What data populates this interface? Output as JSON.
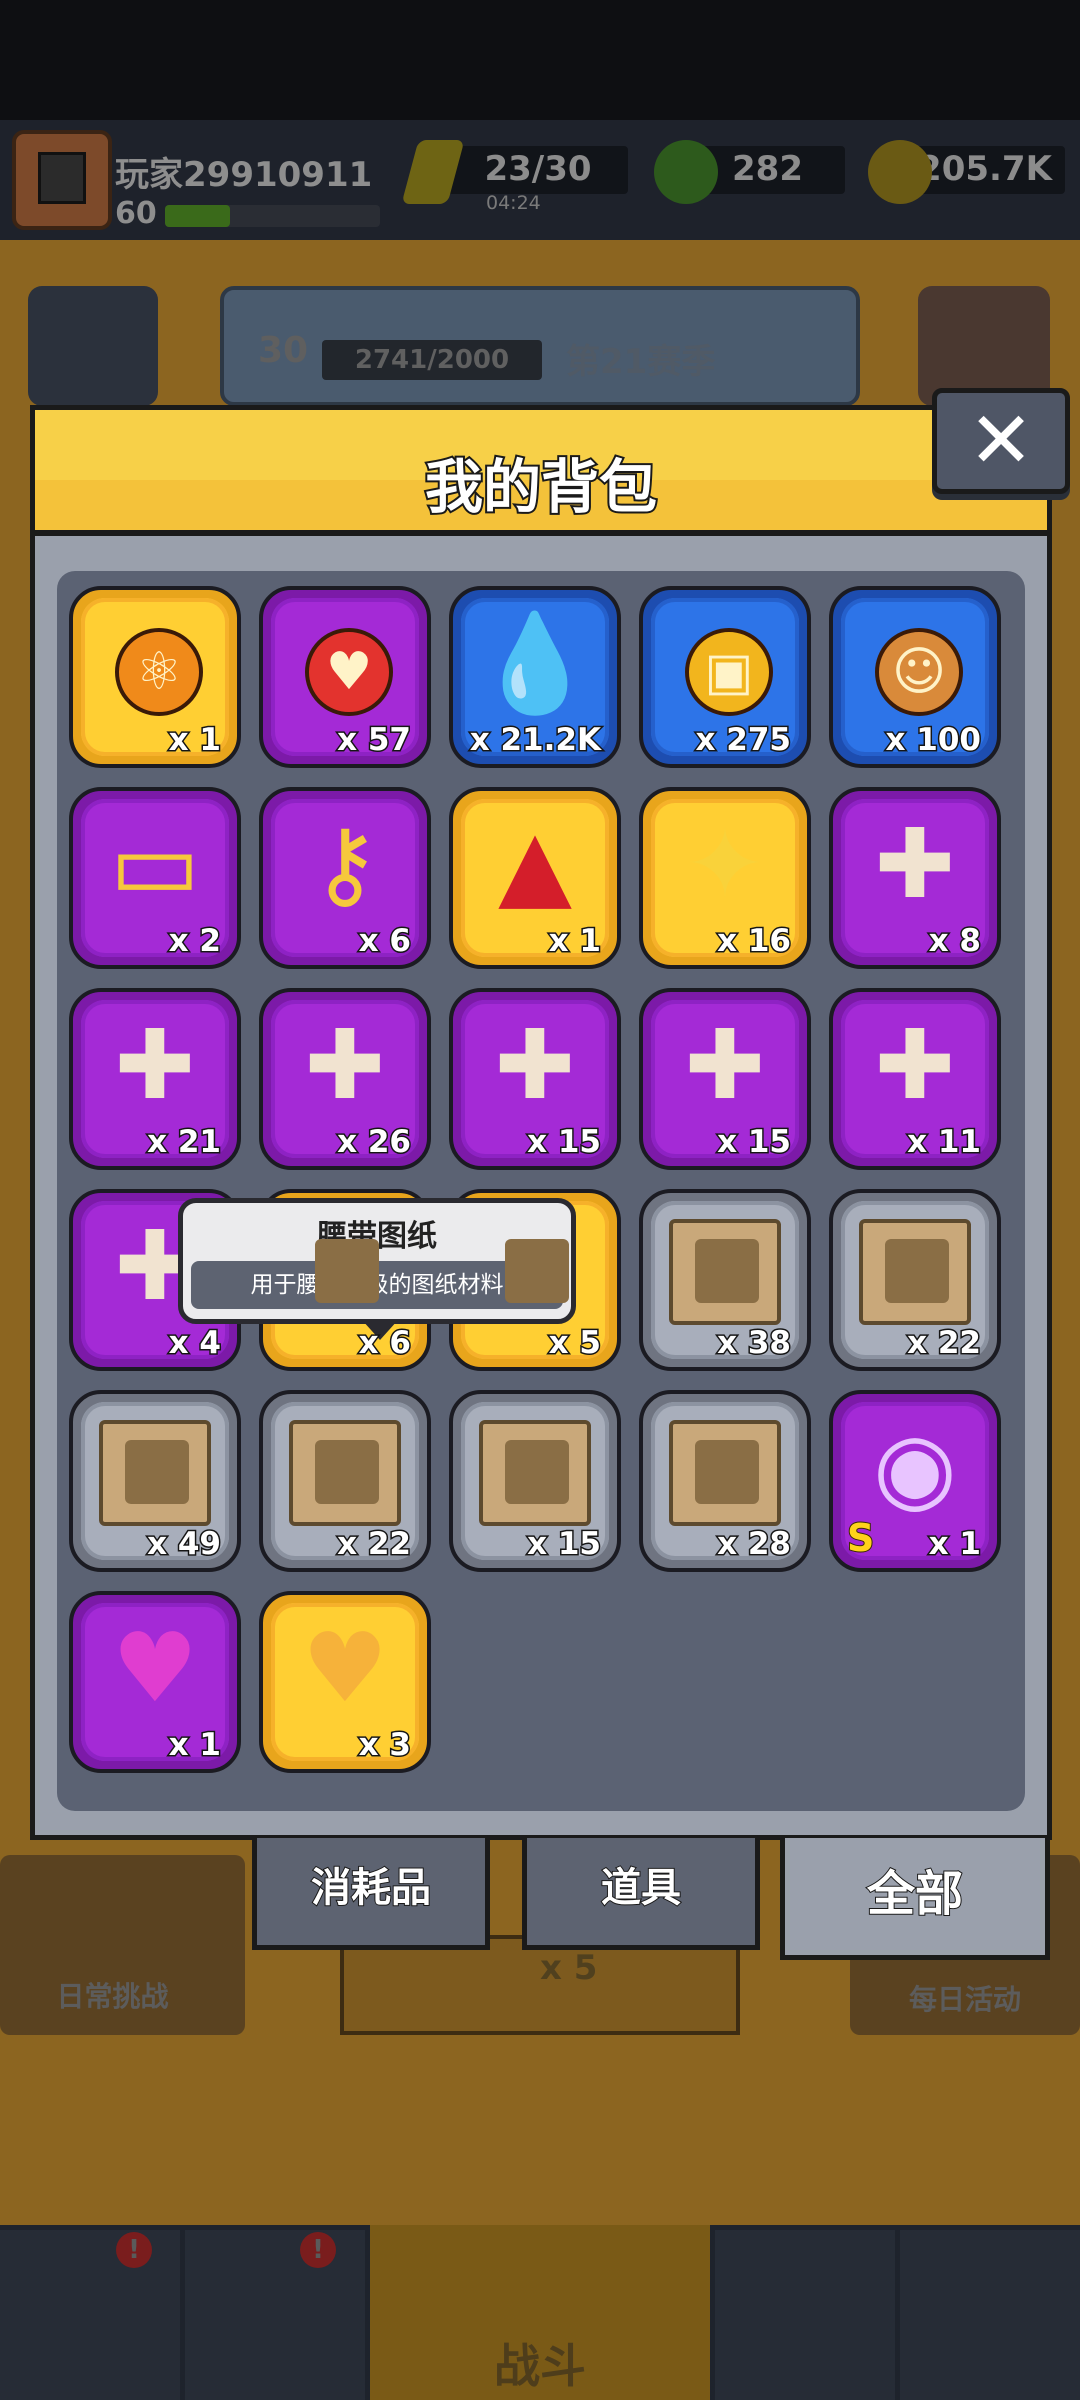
{
  "player": {
    "name": "玩家29910911",
    "level": "60",
    "xp_fraction": 0.3
  },
  "resources": {
    "energy": "23/30",
    "energy_timer": "04:24",
    "gems": "282",
    "coins": "205.7K"
  },
  "background": {
    "season_level": "30",
    "season_progress": "2741/2000",
    "season_name": "第21赛季",
    "daily_challenge": "日常挑战",
    "daily_event": "每日活动",
    "energy_cost": "x 5",
    "battle": "战斗",
    "notif_mark": "!"
  },
  "modal": {
    "title": "我的背包",
    "close_glyph": "✕"
  },
  "tooltip": {
    "title": "腰带图纸",
    "description": "用于腰带升级的图纸材料"
  },
  "tabs": {
    "consumables": "消耗品",
    "props": "道具",
    "all": "全部"
  },
  "items": [
    {
      "icon": "orange-rune-orb-icon",
      "rarity": "gold",
      "count": "x 1"
    },
    {
      "icon": "heart-orb-icon",
      "rarity": "purple",
      "count": "x 57"
    },
    {
      "icon": "golden-drop-icon",
      "rarity": "blue",
      "count": "x 21.2K"
    },
    {
      "icon": "gold-cube-coin-icon",
      "rarity": "blue",
      "count": "x 275"
    },
    {
      "icon": "dog-cookie-icon",
      "rarity": "blue",
      "count": "x 100"
    },
    {
      "icon": "gold-ticket-icon",
      "rarity": "purple",
      "count": "x 2"
    },
    {
      "icon": "gem-key-icon",
      "rarity": "purple",
      "count": "x 6"
    },
    {
      "icon": "red-triangle-gem-icon",
      "rarity": "gold",
      "count": "x 1"
    },
    {
      "icon": "gold-star-icon",
      "rarity": "gold",
      "count": "x 16"
    },
    {
      "icon": "hero-puzzle-piece-icon",
      "rarity": "purple",
      "count": "x 8"
    },
    {
      "icon": "hero-puzzle-piece-icon",
      "rarity": "purple",
      "count": "x 21"
    },
    {
      "icon": "hero-puzzle-piece-icon",
      "rarity": "purple",
      "count": "x 26"
    },
    {
      "icon": "hero-puzzle-piece-icon",
      "rarity": "purple",
      "count": "x 15"
    },
    {
      "icon": "hero-puzzle-piece-icon",
      "rarity": "purple",
      "count": "x 15"
    },
    {
      "icon": "hero-puzzle-piece-icon",
      "rarity": "purple",
      "count": "x 11"
    },
    {
      "icon": "hero-puzzle-piece-icon",
      "rarity": "purple",
      "count": "x 4"
    },
    {
      "icon": "belt-blueprint-icon",
      "rarity": "gold",
      "count": "x 6"
    },
    {
      "icon": "blueprint-scroll-icon",
      "rarity": "gold",
      "count": "x 5"
    },
    {
      "icon": "weapon-blueprint-icon",
      "rarity": "gray",
      "count": "x 38"
    },
    {
      "icon": "armor-blueprint-icon",
      "rarity": "gray",
      "count": "x 22"
    },
    {
      "icon": "necklace-blueprint-icon",
      "rarity": "gray",
      "count": "x 49"
    },
    {
      "icon": "belt-blueprint-icon",
      "rarity": "gray",
      "count": "x 22"
    },
    {
      "icon": "glove-blueprint-icon",
      "rarity": "gray",
      "count": "x 15"
    },
    {
      "icon": "boots-blueprint-icon",
      "rarity": "gray",
      "count": "x 28"
    },
    {
      "icon": "s-grade-chest-icon",
      "rarity": "purple",
      "count": "x 1",
      "badge": "S"
    },
    {
      "icon": "purple-heart-chest-icon",
      "rarity": "purple",
      "count": "x 1"
    },
    {
      "icon": "gold-heart-chest-icon",
      "rarity": "gold",
      "count": "x 3"
    }
  ],
  "colors": {
    "gold_tile": "#ffcf33",
    "purple_tile": "#a42ad6",
    "blue_tile": "#2d74e8",
    "gray_tile": "#a8aebb",
    "header": "#f4c23a",
    "panel": "#5b6273"
  }
}
